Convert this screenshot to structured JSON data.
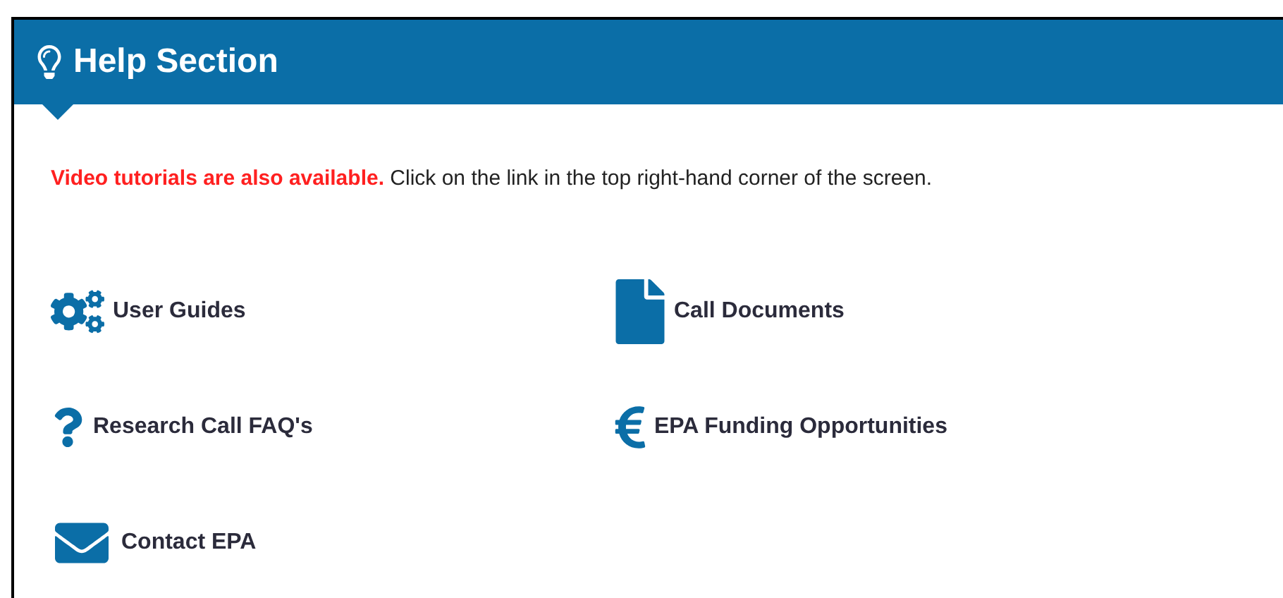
{
  "panel": {
    "title": "Help Section"
  },
  "notice": {
    "highlight": "Video tutorials are also available.",
    "text": "Click on the link in the top right-hand corner of the screen."
  },
  "links": [
    {
      "label": "User Guides"
    },
    {
      "label": "Call Documents"
    },
    {
      "label": "Research Call FAQ's"
    },
    {
      "label": "EPA Funding Opportunities"
    },
    {
      "label": "Contact EPA"
    }
  ]
}
